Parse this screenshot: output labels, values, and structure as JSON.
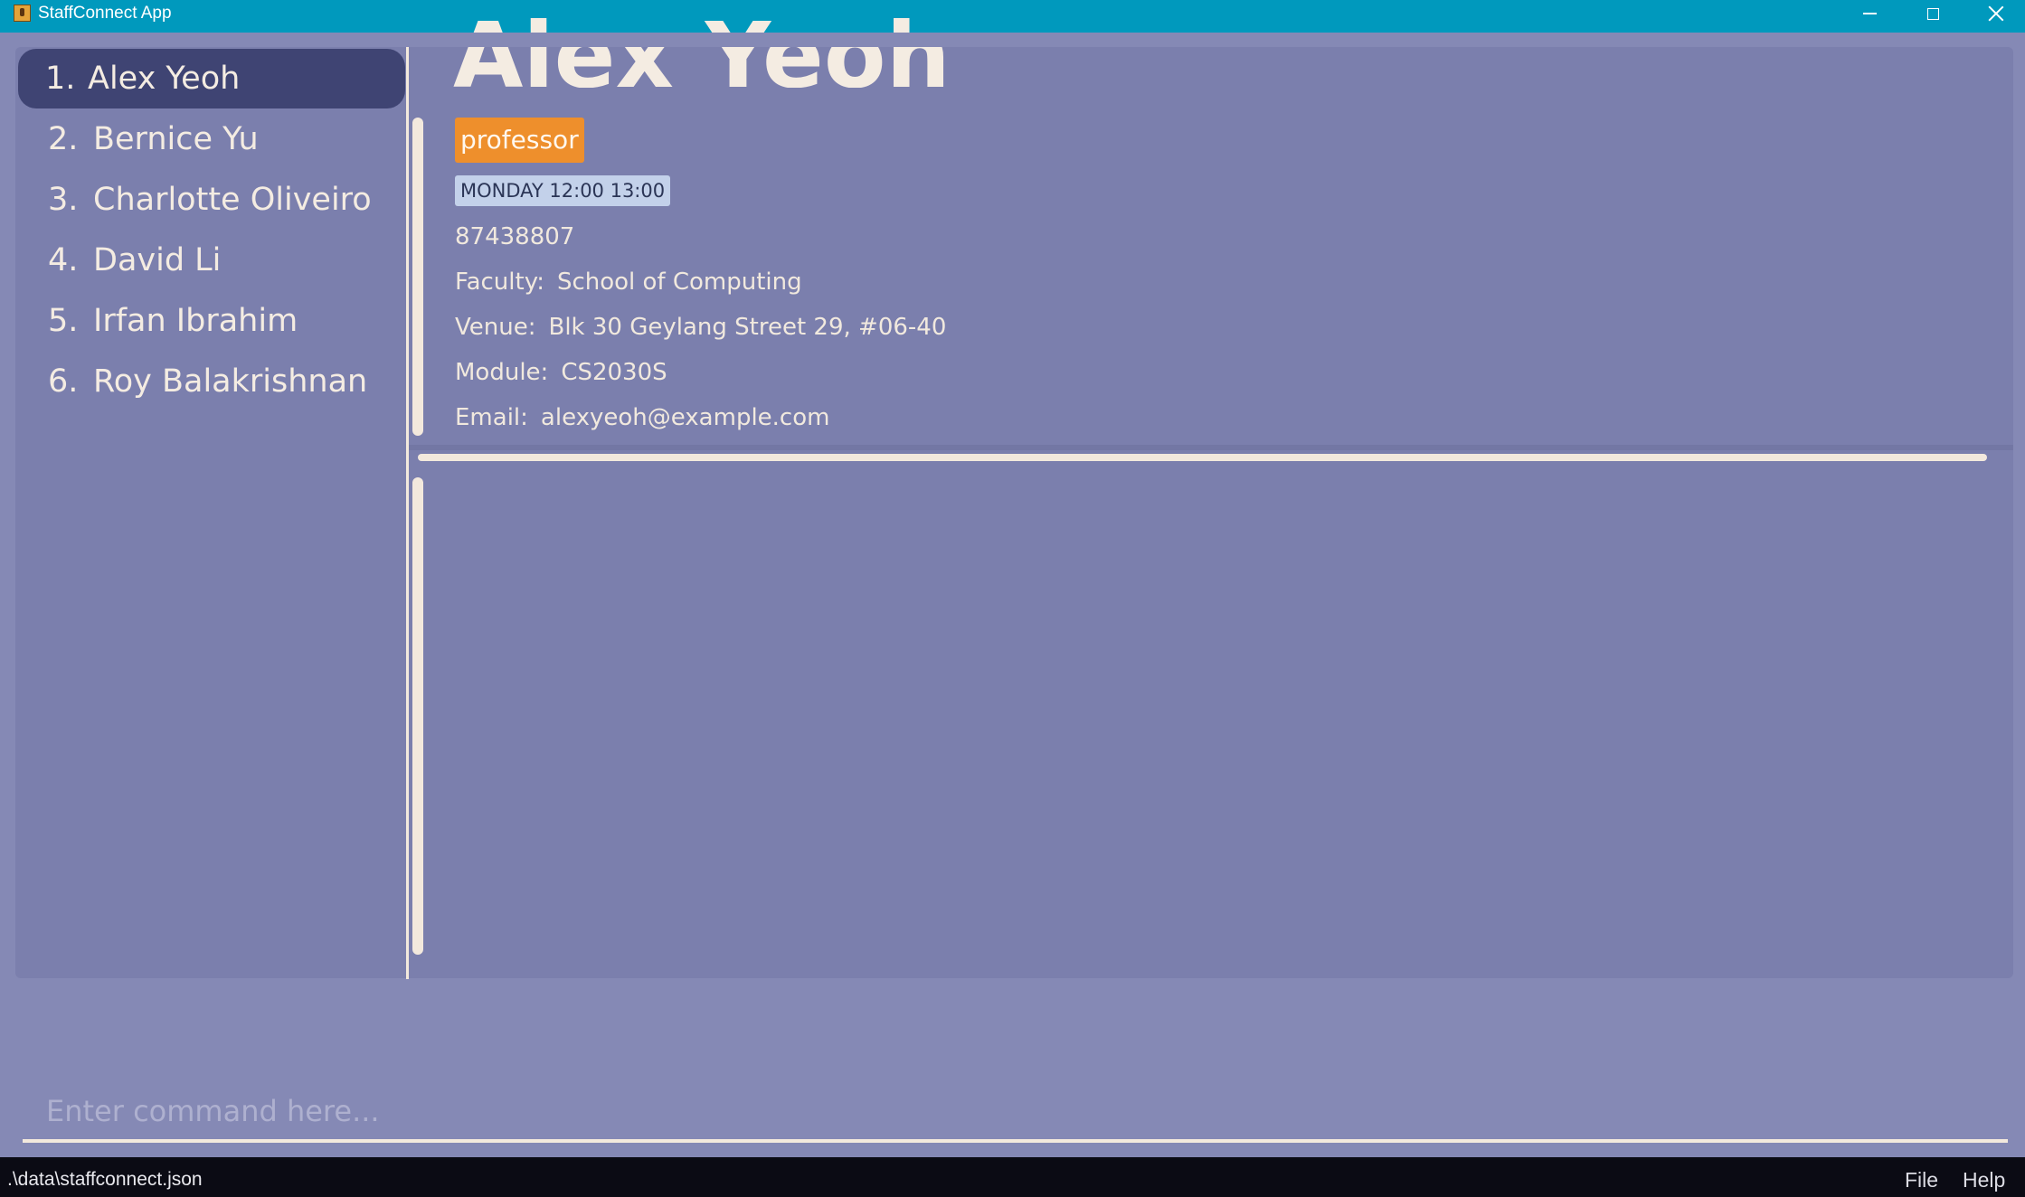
{
  "window": {
    "title": "StaffConnect App",
    "icon": "app-icon"
  },
  "sidebar": {
    "items": [
      {
        "num": "1.",
        "name": "Alex Yeoh",
        "selected": true
      },
      {
        "num": "2.",
        "name": "Bernice Yu"
      },
      {
        "num": "3.",
        "name": "Charlotte Oliveiro"
      },
      {
        "num": "4.",
        "name": "David Li"
      },
      {
        "num": "5.",
        "name": "Irfan Ibrahim"
      },
      {
        "num": "6.",
        "name": "Roy Balakrishnan"
      }
    ]
  },
  "detail": {
    "name": "Alex Yeoh",
    "tag": "professor",
    "schedule": "MONDAY 12:00 13:00",
    "phone": "87438807",
    "faculty_label": "Faculty:",
    "faculty": "School of Computing",
    "venue_label": "Venue:",
    "venue": "Blk 30 Geylang Street 29, #06-40",
    "module_label": "Module:",
    "module": "CS2030S",
    "email_label": "Email:",
    "email": "alexyeoh@example.com"
  },
  "command": {
    "placeholder": "Enter command here...",
    "value": ""
  },
  "statusbar": {
    "path": ".\\data\\staffconnect.json",
    "menu": [
      "File",
      "Help"
    ]
  },
  "colors": {
    "titlebar": "#0099bd",
    "background": "#8589b5",
    "panel": "#7b7fad",
    "selected_item": "#3f4473",
    "tag": "#ee8f2c",
    "schedule": "#c3d1ea"
  }
}
